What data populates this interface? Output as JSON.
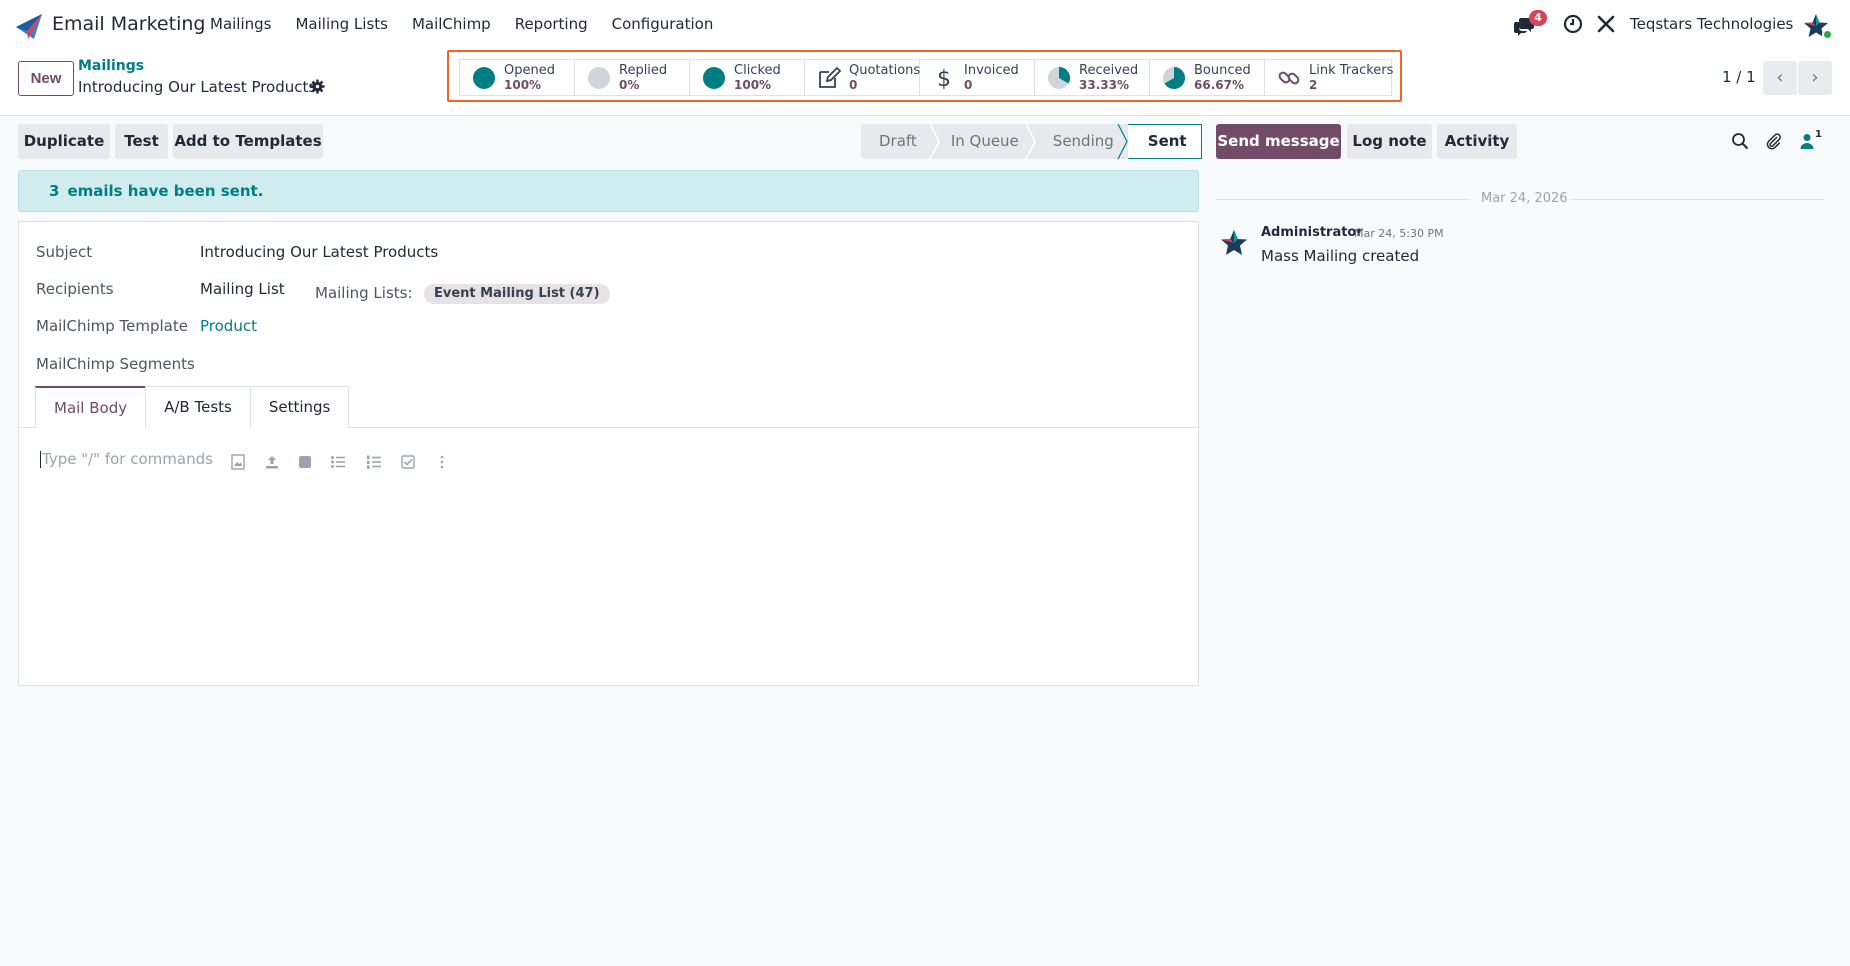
{
  "app": {
    "name": "Email Marketing",
    "menu": [
      "Mailings",
      "Mailing Lists",
      "MailChimp",
      "Reporting",
      "Configuration"
    ],
    "notifications": "4",
    "company": "Teqstars Technologies"
  },
  "control": {
    "new_label": "New",
    "breadcrumb_parent": "Mailings",
    "breadcrumb_current": "Introducing Our Latest Products",
    "pager": "1 / 1"
  },
  "stats": [
    {
      "label": "Opened",
      "value": "100%",
      "icon": "pie-full-icon"
    },
    {
      "label": "Replied",
      "value": "0%",
      "icon": "pie-empty-icon"
    },
    {
      "label": "Clicked",
      "value": "100%",
      "icon": "pie-full-icon"
    },
    {
      "label": "Quotations",
      "value": "0",
      "icon": "pencil-square-icon"
    },
    {
      "label": "Invoiced",
      "value": "0",
      "icon": "dollar-icon"
    },
    {
      "label": "Received",
      "value": "33.33%",
      "icon": "pie-third-icon",
      "fraction": 0.3333
    },
    {
      "label": "Bounced",
      "value": "66.67%",
      "icon": "pie-two-thirds-icon",
      "fraction": 0.6667
    },
    {
      "label": "Link Trackers",
      "value": "2",
      "icon": "link-icon"
    }
  ],
  "actions": {
    "duplicate": "Duplicate",
    "test": "Test",
    "add_templates": "Add to Templates"
  },
  "stages": [
    "Draft",
    "In Queue",
    "Sending",
    "Sent"
  ],
  "alert": {
    "count": "3",
    "text": "emails have been sent."
  },
  "form": {
    "subject_label": "Subject",
    "subject_value": "Introducing Our Latest Products",
    "recipients_label": "Recipients",
    "recipients_value": "Mailing List",
    "mailing_lists_label": "Mailing Lists:",
    "mailing_list_tag": "Event Mailing List (47)",
    "template_label": "MailChimp Template",
    "template_value": "Product",
    "segments_label": "MailChimp Segments",
    "tabs": [
      "Mail Body",
      "A/B Tests",
      "Settings"
    ],
    "editor_placeholder": "Type \"/\" for commands"
  },
  "chatter": {
    "send_message": "Send message",
    "log_note": "Log note",
    "activity": "Activity",
    "followers": "1",
    "date": "Mar 24, 2026",
    "message": {
      "author": "Administrator",
      "date": "Mar 24, 5:30 PM",
      "body": "Mass Mailing created"
    }
  },
  "colors": {
    "brand": "#714b67",
    "teal": "#017e84",
    "highlight": "#f26522",
    "badge": "#d9435a"
  }
}
